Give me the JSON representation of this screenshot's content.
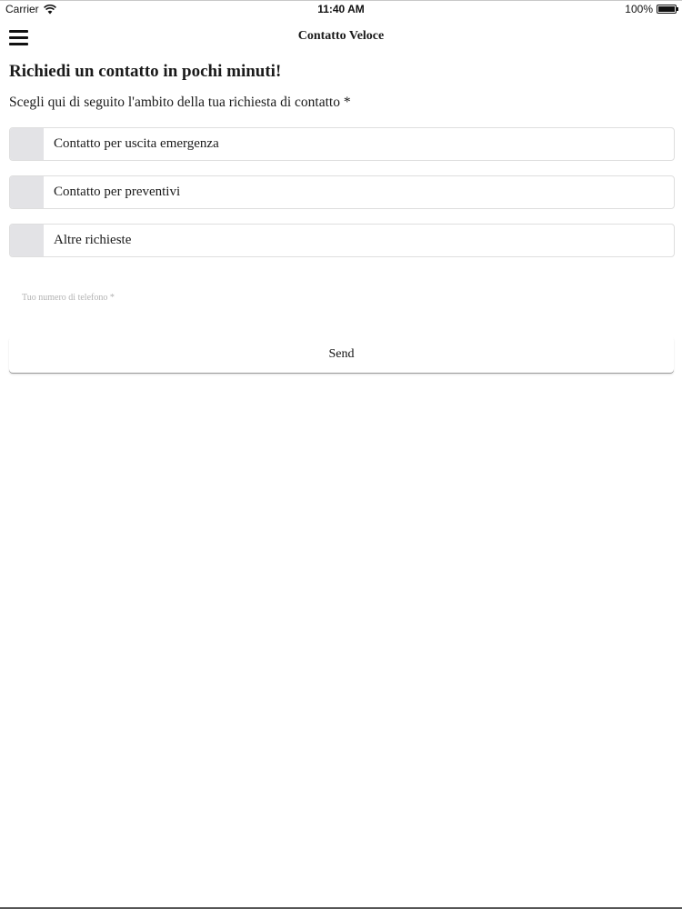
{
  "status_bar": {
    "carrier": "Carrier",
    "wifi_icon": "wifi-icon",
    "time": "11:40 AM",
    "battery": "100%",
    "battery_icon": "battery-icon"
  },
  "nav": {
    "menu_icon": "hamburger-menu-icon",
    "title": "Contatto Veloce"
  },
  "form": {
    "heading": "Richiedi un contatto in pochi minuti!",
    "subtitle": "Scegli qui di seguito l'ambito della tua richiesta di contatto *",
    "options": [
      {
        "label": "Contatto per uscita emergenza",
        "checked": false
      },
      {
        "label": "Contatto per preventivi",
        "checked": false
      },
      {
        "label": "Altre richieste",
        "checked": false
      }
    ],
    "phone": {
      "value": "",
      "placeholder": "Tuo numero di telefono *"
    },
    "send_label": "Send"
  },
  "colors": {
    "checkbox_fill": "#e3e3e6",
    "option_border": "#dedede",
    "placeholder": "#b3b3b3"
  }
}
